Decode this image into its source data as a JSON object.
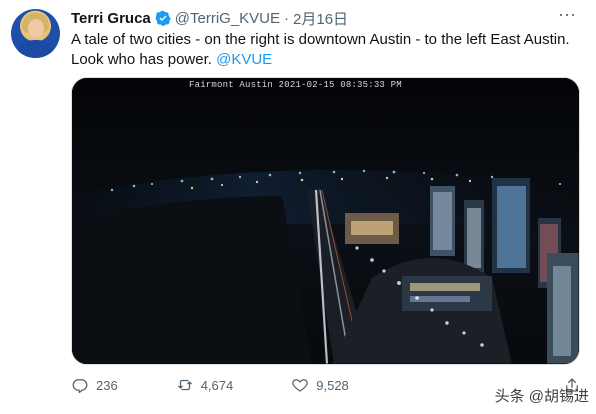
{
  "tweet": {
    "author_name": "Terri Gruca",
    "handle": "@TerriG_KVUE",
    "separator": "·",
    "date": "2月16日",
    "text": "A tale of two cities - on the right is downtown Austin - to the left East Austin. Look who has power. ",
    "mention": "@KVUE",
    "media_overlay": "Fairmont Austin   2021-02-15   08:35:33 PM"
  },
  "actions": {
    "reply_count": "236",
    "retweet_count": "4,674",
    "like_count": "9,528"
  },
  "watermark": "头条 @胡锡进",
  "icons": {
    "verified": "verified-badge-icon",
    "more": "more-icon",
    "reply": "reply-icon",
    "retweet": "retweet-icon",
    "like": "like-icon",
    "share": "share-icon"
  },
  "colors": {
    "accent": "#1d9bf0",
    "text_primary": "#0f1419",
    "text_secondary": "#536471"
  }
}
